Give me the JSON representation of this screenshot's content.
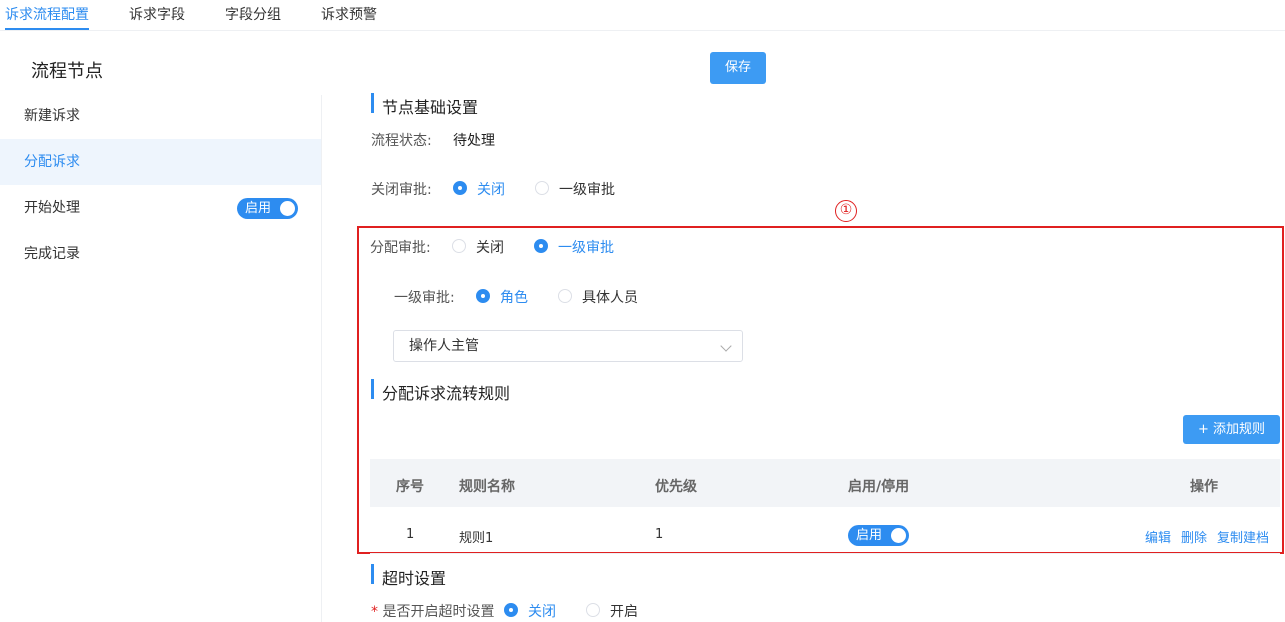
{
  "tabs": [
    {
      "label": "诉求流程配置",
      "active": true
    },
    {
      "label": "诉求字段"
    },
    {
      "label": "字段分组"
    },
    {
      "label": "诉求预警"
    }
  ],
  "sidebar": {
    "title": "流程节点",
    "items": [
      {
        "label": "新建诉求"
      },
      {
        "label": "分配诉求",
        "active": true
      },
      {
        "label": "开始处理",
        "toggle": "启用"
      },
      {
        "label": "完成记录"
      }
    ]
  },
  "toolbar": {
    "save_label": "保存"
  },
  "basic": {
    "title": "节点基础设置",
    "status_label": "流程状态:",
    "status_value": "待处理",
    "close_label": "关闭审批:",
    "close_options": [
      "关闭",
      "一级审批"
    ],
    "close_selected": "关闭"
  },
  "annotation": {
    "marker": "①"
  },
  "assign": {
    "label": "分配审批:",
    "options": [
      "关闭",
      "一级审批"
    ],
    "selected": "一级审批",
    "level1_label": "一级审批:",
    "level1_options": [
      "角色",
      "具体人员"
    ],
    "level1_selected": "角色",
    "select_value": "操作人主管"
  },
  "rules": {
    "title": "分配诉求流转规则",
    "add_label": "+ 添加规则",
    "columns": [
      "序号",
      "规则名称",
      "优先级",
      "启用/停用",
      "操作"
    ],
    "rows": [
      {
        "index": "1",
        "name": "规则1",
        "priority": "1",
        "status": "启用",
        "actions": [
          "编辑",
          "删除",
          "复制建档"
        ]
      }
    ]
  },
  "timeout": {
    "title": "超时设置",
    "required_mark": "*",
    "label": "是否开启超时设置",
    "options": [
      "关闭",
      "开启"
    ],
    "selected": "关闭"
  },
  "colors": {
    "accent": "#2d8cf0",
    "annotation": "#e02020"
  }
}
